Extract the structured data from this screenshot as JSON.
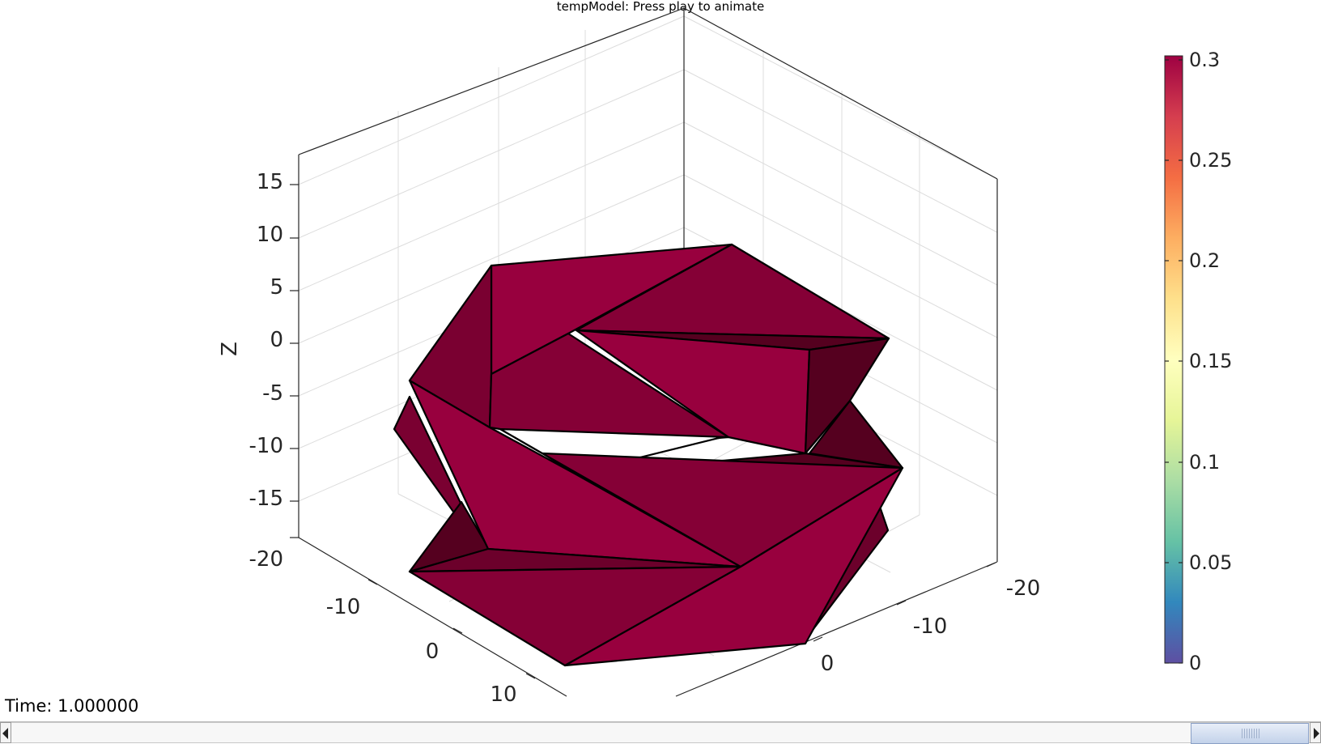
{
  "title": "tempModel: Press play to animate",
  "axes": {
    "zlabel": "Z",
    "z_ticks": [
      "15",
      "10",
      "5",
      "0",
      "-5",
      "-10",
      "-15",
      "-20"
    ],
    "x_ticks": [
      "-10",
      "0",
      "10"
    ],
    "y_ticks": [
      "-20",
      "-10",
      "0"
    ]
  },
  "colorbar": {
    "ticks": [
      "0.3",
      "0.25",
      "0.2",
      "0.15",
      "0.1",
      "0.05",
      "0"
    ],
    "range": [
      0,
      0.3
    ],
    "colormap": "spectral"
  },
  "surface": {
    "face_color": "#8e003a",
    "face_shades": [
      "#98003e",
      "#850036",
      "#6c002b",
      "#55001f"
    ],
    "edge_color": "#000000"
  },
  "time_label": "Time: 1.000000",
  "scrollbar": {
    "position_fraction": 0.95
  }
}
